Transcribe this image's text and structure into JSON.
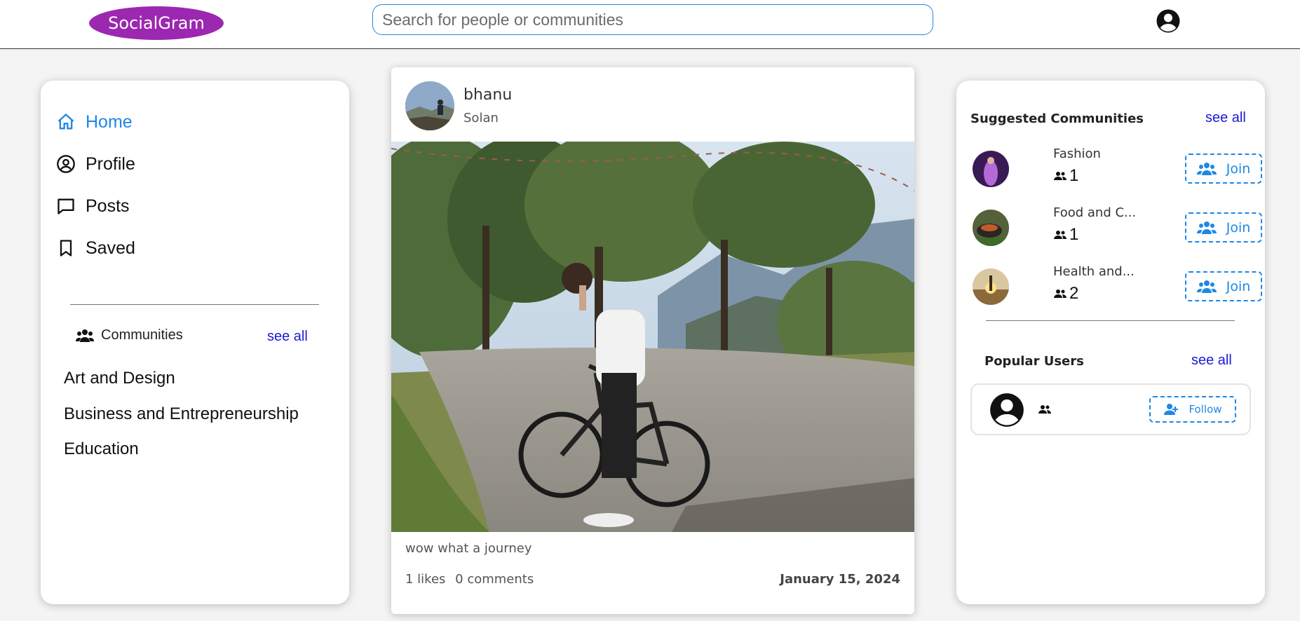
{
  "header": {
    "logo": "SocialGram",
    "search_placeholder": "Search for people or communities",
    "account_icon": "account-circle-icon"
  },
  "sidebar": {
    "nav": [
      {
        "label": "Home",
        "icon": "home-icon",
        "active": true
      },
      {
        "label": "Profile",
        "icon": "account-circle-icon",
        "active": false
      },
      {
        "label": "Posts",
        "icon": "chat-bubble-icon",
        "active": false
      },
      {
        "label": "Saved",
        "icon": "bookmark-icon",
        "active": false
      }
    ],
    "communities_title": "Communities",
    "see_all": "see all",
    "communities": [
      "Art and Design",
      "Business and Entrepreneurship",
      "Education"
    ]
  },
  "post": {
    "username": "bhanu",
    "location": "Solan",
    "caption": "wow what a journey",
    "likes": "1 likes",
    "comments": "0 comments",
    "date": "January 15, 2024"
  },
  "suggested": {
    "title": "Suggested Communities",
    "see_all": "see all",
    "join_label": "Join",
    "items": [
      {
        "name": "Fashion",
        "members": "1"
      },
      {
        "name": "Food and C...",
        "members": "1"
      },
      {
        "name": "Health and...",
        "members": "2"
      }
    ]
  },
  "popular": {
    "title": "Popular Users",
    "see_all": "see all",
    "follow_label": "Follow"
  },
  "colors": {
    "accent": "#1e88e5",
    "brand": "#9c27b0",
    "link": "#1a1ad8"
  }
}
